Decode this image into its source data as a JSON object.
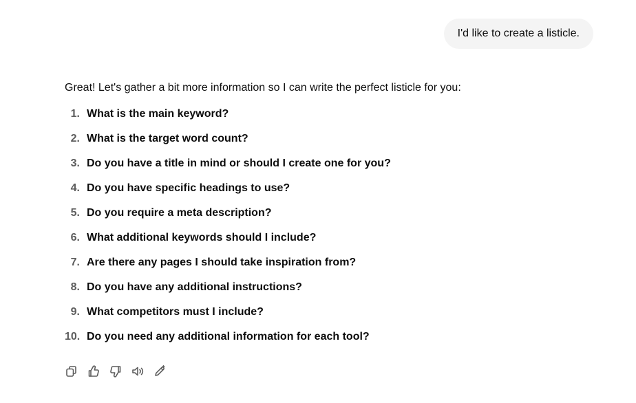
{
  "user_message": "I'd like to create a listicle.",
  "assistant": {
    "intro": "Great! Let's gather a bit more information so I can write the perfect listicle for you:",
    "questions": [
      {
        "num": "1.",
        "text": "What is the main keyword?"
      },
      {
        "num": "2.",
        "text": "What is the target word count?"
      },
      {
        "num": "3.",
        "text": "Do you have a title in mind or should I create one for you?"
      },
      {
        "num": "4.",
        "text": "Do you have specific headings to use?"
      },
      {
        "num": "5.",
        "text": "Do you require a meta description?"
      },
      {
        "num": "6.",
        "text": "What additional keywords should I include?"
      },
      {
        "num": "7.",
        "text": "Are there any pages I should take inspiration from?"
      },
      {
        "num": "8.",
        "text": "Do you have any additional instructions?"
      },
      {
        "num": "9.",
        "text": "What competitors must I include?"
      },
      {
        "num": "10.",
        "text": "Do you need any additional information for each tool?"
      }
    ]
  },
  "actions": {
    "icons": [
      "copy-icon",
      "thumbs-up-icon",
      "thumbs-down-icon",
      "read-aloud-icon",
      "edit-icon"
    ]
  }
}
